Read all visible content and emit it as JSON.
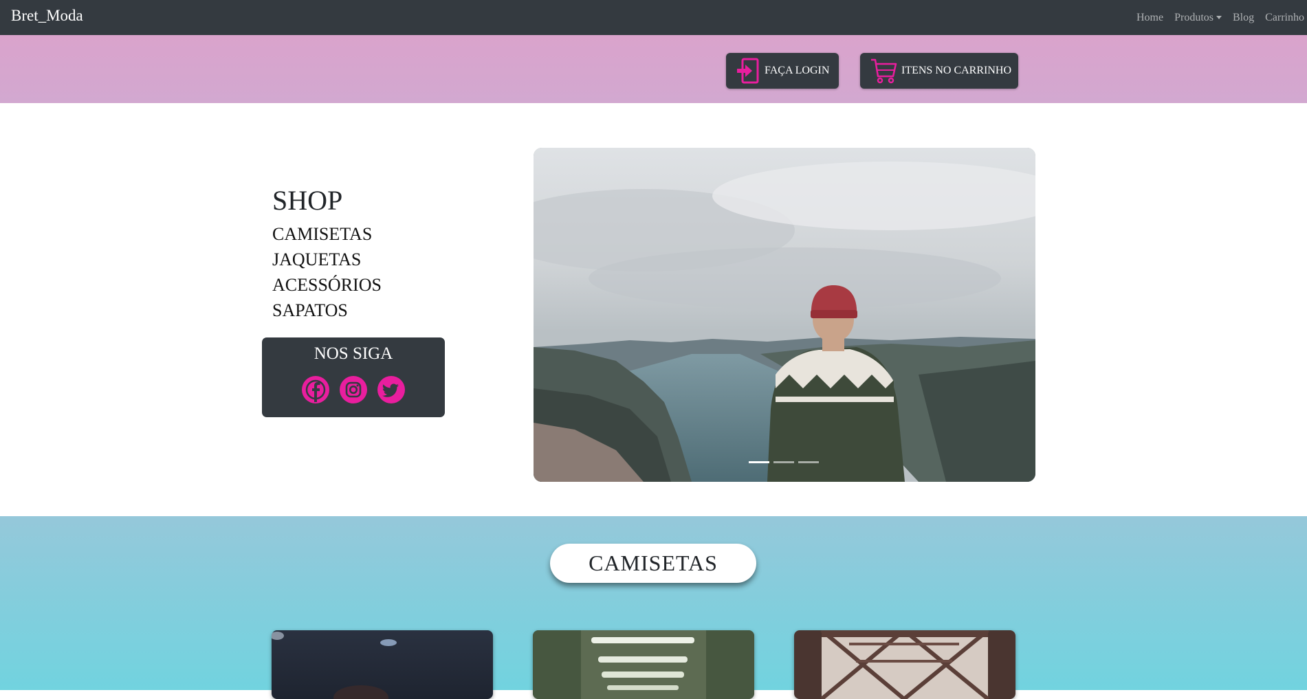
{
  "navbar": {
    "brand": "Bret_Moda",
    "links": {
      "home": "Home",
      "produtos": "Produtos",
      "blog": "Blog",
      "carrinho": "Carrinho"
    }
  },
  "header": {
    "login_label": "FAÇA LOGIN",
    "cart_label": "ITENS NO CARRINHO"
  },
  "shop": {
    "title": "SHOP",
    "items": [
      "CAMISETAS",
      "JAQUETAS",
      "ACESSÓRIOS",
      "SAPATOS"
    ]
  },
  "follow": {
    "title": "NOS SIGA",
    "icons": [
      "facebook-icon",
      "instagram-icon",
      "twitter-icon"
    ]
  },
  "carousel": {
    "slide_count": 3,
    "active_index": 0
  },
  "section": {
    "title": "CAMISETAS"
  },
  "colors": {
    "navbar": "#343a40",
    "accent": "#e91e9e",
    "band": "#d6a5ce",
    "section": "#7fd0de"
  }
}
